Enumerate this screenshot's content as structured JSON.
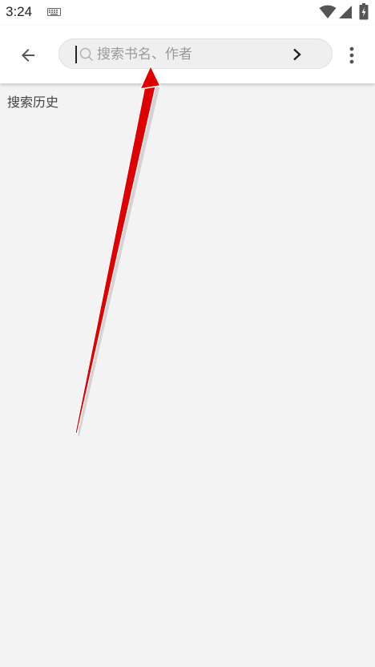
{
  "status_bar": {
    "time": "3:24",
    "icons": [
      "keyboard-icon",
      "wifi-icon",
      "signal-icon",
      "battery-icon"
    ]
  },
  "toolbar": {
    "back_icon": "back-arrow-icon",
    "search": {
      "placeholder": "搜索书名、作者",
      "value": "",
      "icon": "search-icon",
      "submit_icon": "chevron-right-icon"
    },
    "more_icon": "more-vert-icon"
  },
  "history": {
    "title": "搜索历史",
    "items": []
  },
  "colors": {
    "background": "#f3f3f3",
    "toolbar": "#ffffff",
    "search_box": "#efefef",
    "annotation_arrow": "#e00000"
  }
}
